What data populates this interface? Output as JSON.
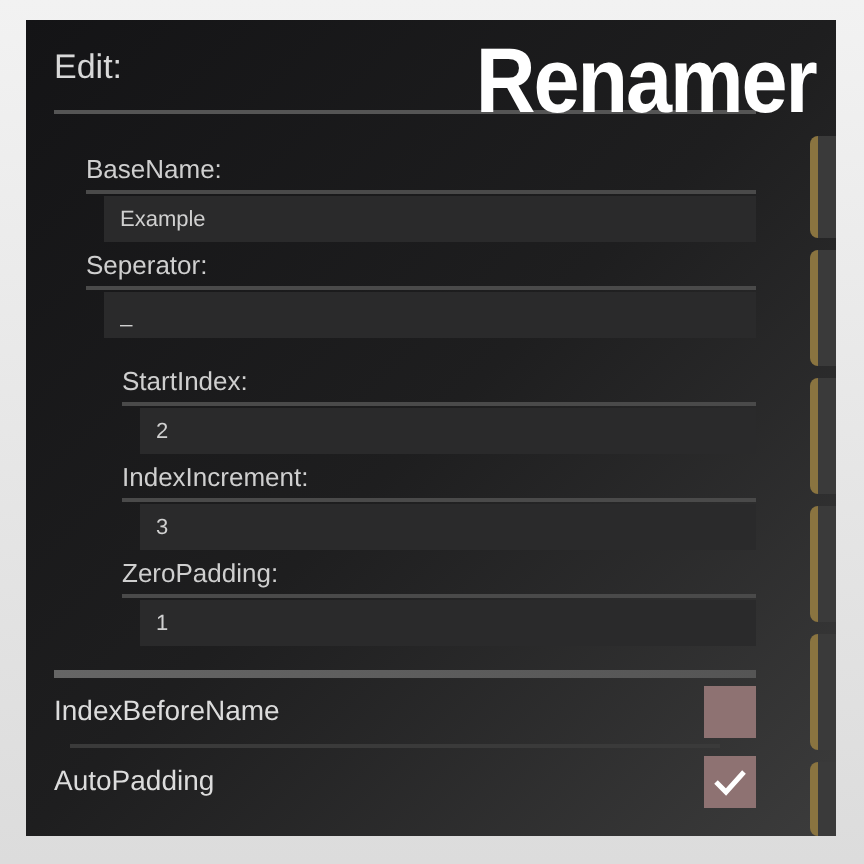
{
  "title": "Renamer",
  "section": "Edit:",
  "fields": [
    {
      "label": "BaseName:",
      "value": "Example"
    },
    {
      "label": "Seperator:",
      "value": "_"
    }
  ],
  "index_fields": [
    {
      "label": "StartIndex:",
      "value": "2"
    },
    {
      "label": "IndexIncrement:",
      "value": "3"
    },
    {
      "label": "ZeroPadding:",
      "value": "1"
    }
  ],
  "checkboxes": [
    {
      "label": "IndexBeforeName",
      "checked": false
    },
    {
      "label": "AutoPadding",
      "checked": true
    }
  ]
}
